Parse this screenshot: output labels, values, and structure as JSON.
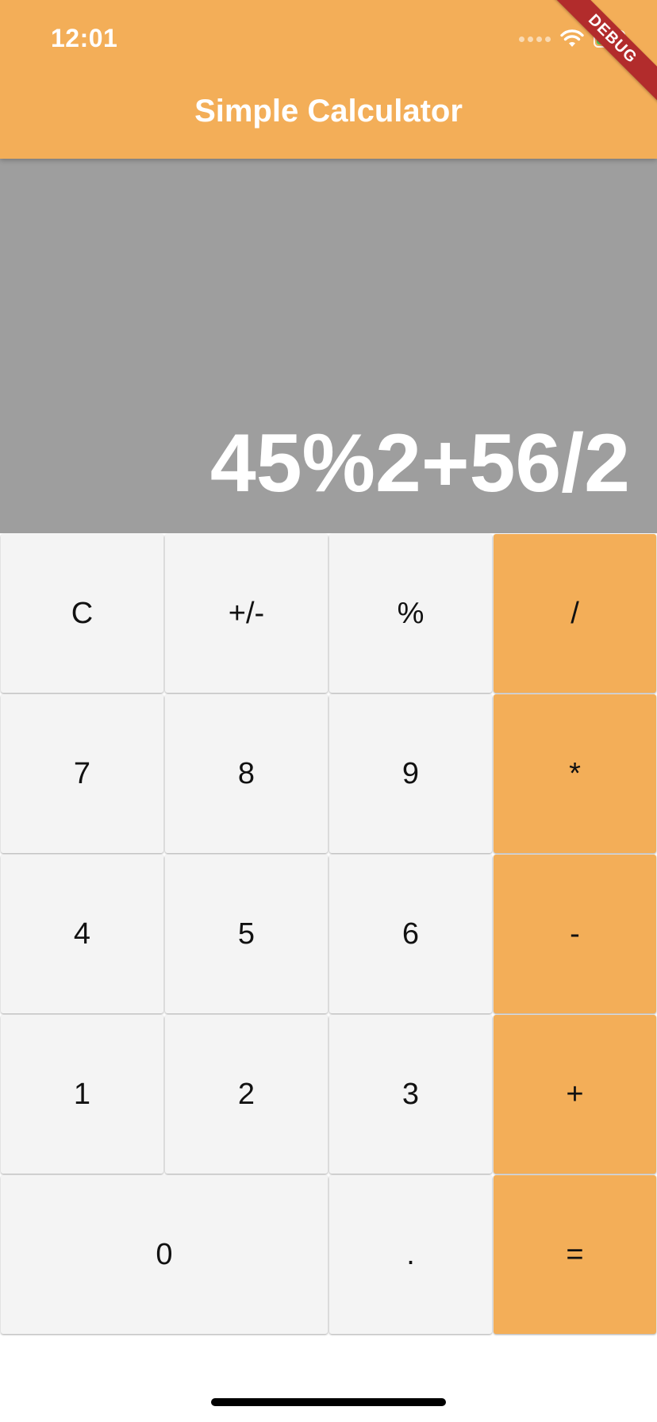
{
  "status_bar": {
    "time": "12:01"
  },
  "app_bar": {
    "title": "Simple Calculator",
    "background_color": "#F3AE58"
  },
  "debug_banner": {
    "label": "DEBUG",
    "color": "#B22C2C"
  },
  "display": {
    "expression": "45%2+56/2",
    "background_color": "#9E9E9E"
  },
  "keypad": {
    "rows": [
      [
        {
          "label": "C",
          "name": "clear-button",
          "type": "function"
        },
        {
          "label": "+/-",
          "name": "negate-button",
          "type": "function"
        },
        {
          "label": "%",
          "name": "percent-button",
          "type": "function"
        },
        {
          "label": "/",
          "name": "divide-button",
          "type": "operator"
        }
      ],
      [
        {
          "label": "7",
          "name": "digit-7-button",
          "type": "digit"
        },
        {
          "label": "8",
          "name": "digit-8-button",
          "type": "digit"
        },
        {
          "label": "9",
          "name": "digit-9-button",
          "type": "digit"
        },
        {
          "label": "*",
          "name": "multiply-button",
          "type": "operator"
        }
      ],
      [
        {
          "label": "4",
          "name": "digit-4-button",
          "type": "digit"
        },
        {
          "label": "5",
          "name": "digit-5-button",
          "type": "digit"
        },
        {
          "label": "6",
          "name": "digit-6-button",
          "type": "digit"
        },
        {
          "label": "-",
          "name": "subtract-button",
          "type": "operator"
        }
      ],
      [
        {
          "label": "1",
          "name": "digit-1-button",
          "type": "digit"
        },
        {
          "label": "2",
          "name": "digit-2-button",
          "type": "digit"
        },
        {
          "label": "3",
          "name": "digit-3-button",
          "type": "digit"
        },
        {
          "label": "+",
          "name": "add-button",
          "type": "operator"
        }
      ],
      [
        {
          "label": "0",
          "name": "digit-0-button",
          "type": "digit",
          "span": 2
        },
        {
          "label": ".",
          "name": "decimal-button",
          "type": "digit"
        },
        {
          "label": "=",
          "name": "equals-button",
          "type": "operator"
        }
      ]
    ],
    "digit_key_color": "#F4F4F4",
    "operator_key_color": "#F3AE58"
  }
}
